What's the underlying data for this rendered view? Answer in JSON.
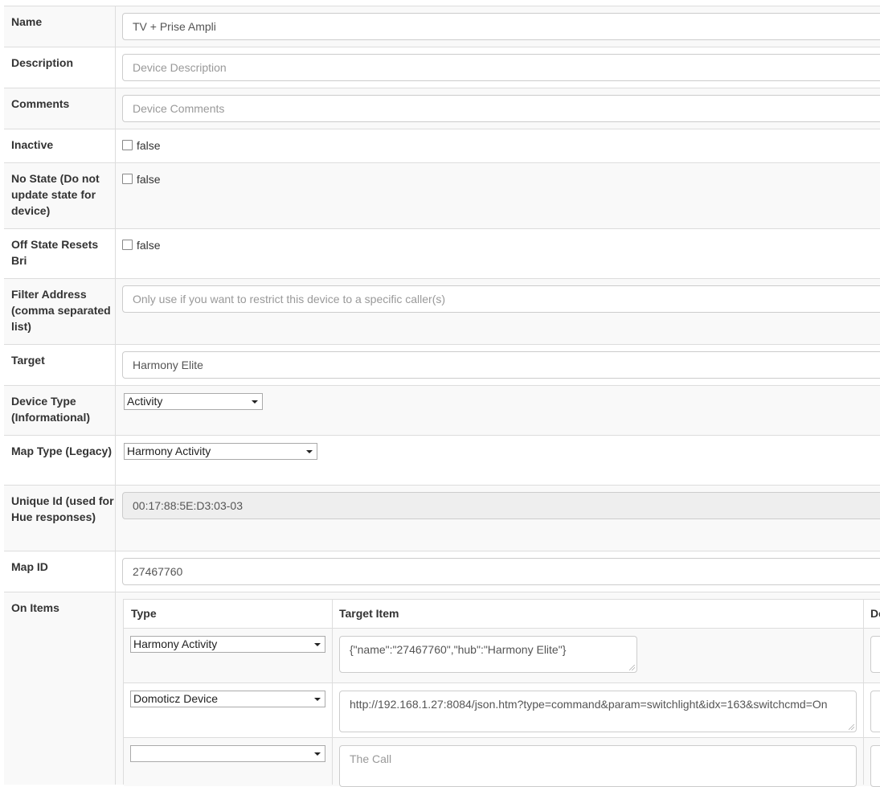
{
  "fields": {
    "name": {
      "label": "Name",
      "value": "TV + Prise Ampli"
    },
    "description": {
      "label": "Description",
      "placeholder": "Device Description"
    },
    "comments": {
      "label": "Comments",
      "placeholder": "Device Comments"
    },
    "inactive": {
      "label": "Inactive",
      "value": "false"
    },
    "no_state": {
      "label": "No State (Do not update state for device)",
      "value": "false"
    },
    "off_state": {
      "label": "Off State Resets Bri",
      "value": "false"
    },
    "filter_address": {
      "label": "Filter Address (comma separated list)",
      "placeholder": "Only use if you want to restrict this device to a specific caller(s)"
    },
    "target": {
      "label": "Target",
      "value": "Harmony Elite"
    },
    "device_type": {
      "label": "Device Type (Informational)",
      "value": "Activity"
    },
    "map_type": {
      "label": "Map Type (Legacy)",
      "value": "Harmony Activity"
    },
    "unique_id": {
      "label": "Unique Id (used for Hue responses)",
      "value": "00:17:88:5E:D3:03-03"
    },
    "map_id": {
      "label": "Map ID",
      "value": "27467760"
    }
  },
  "on_items": {
    "label": "On Items",
    "columns": [
      "Type",
      "Target Item",
      "De"
    ],
    "rows": [
      {
        "type": "Harmony Activity",
        "target": "{\"name\":\"27467760\",\"hub\":\"Harmony Elite\"}"
      },
      {
        "type": "Domoticz Device",
        "target": "http://192.168.1.27:8084/json.htm?type=command&param=switchlight&idx=163&switchcmd=On"
      },
      {
        "type": "",
        "target_placeholder": "The Call"
      }
    ]
  }
}
